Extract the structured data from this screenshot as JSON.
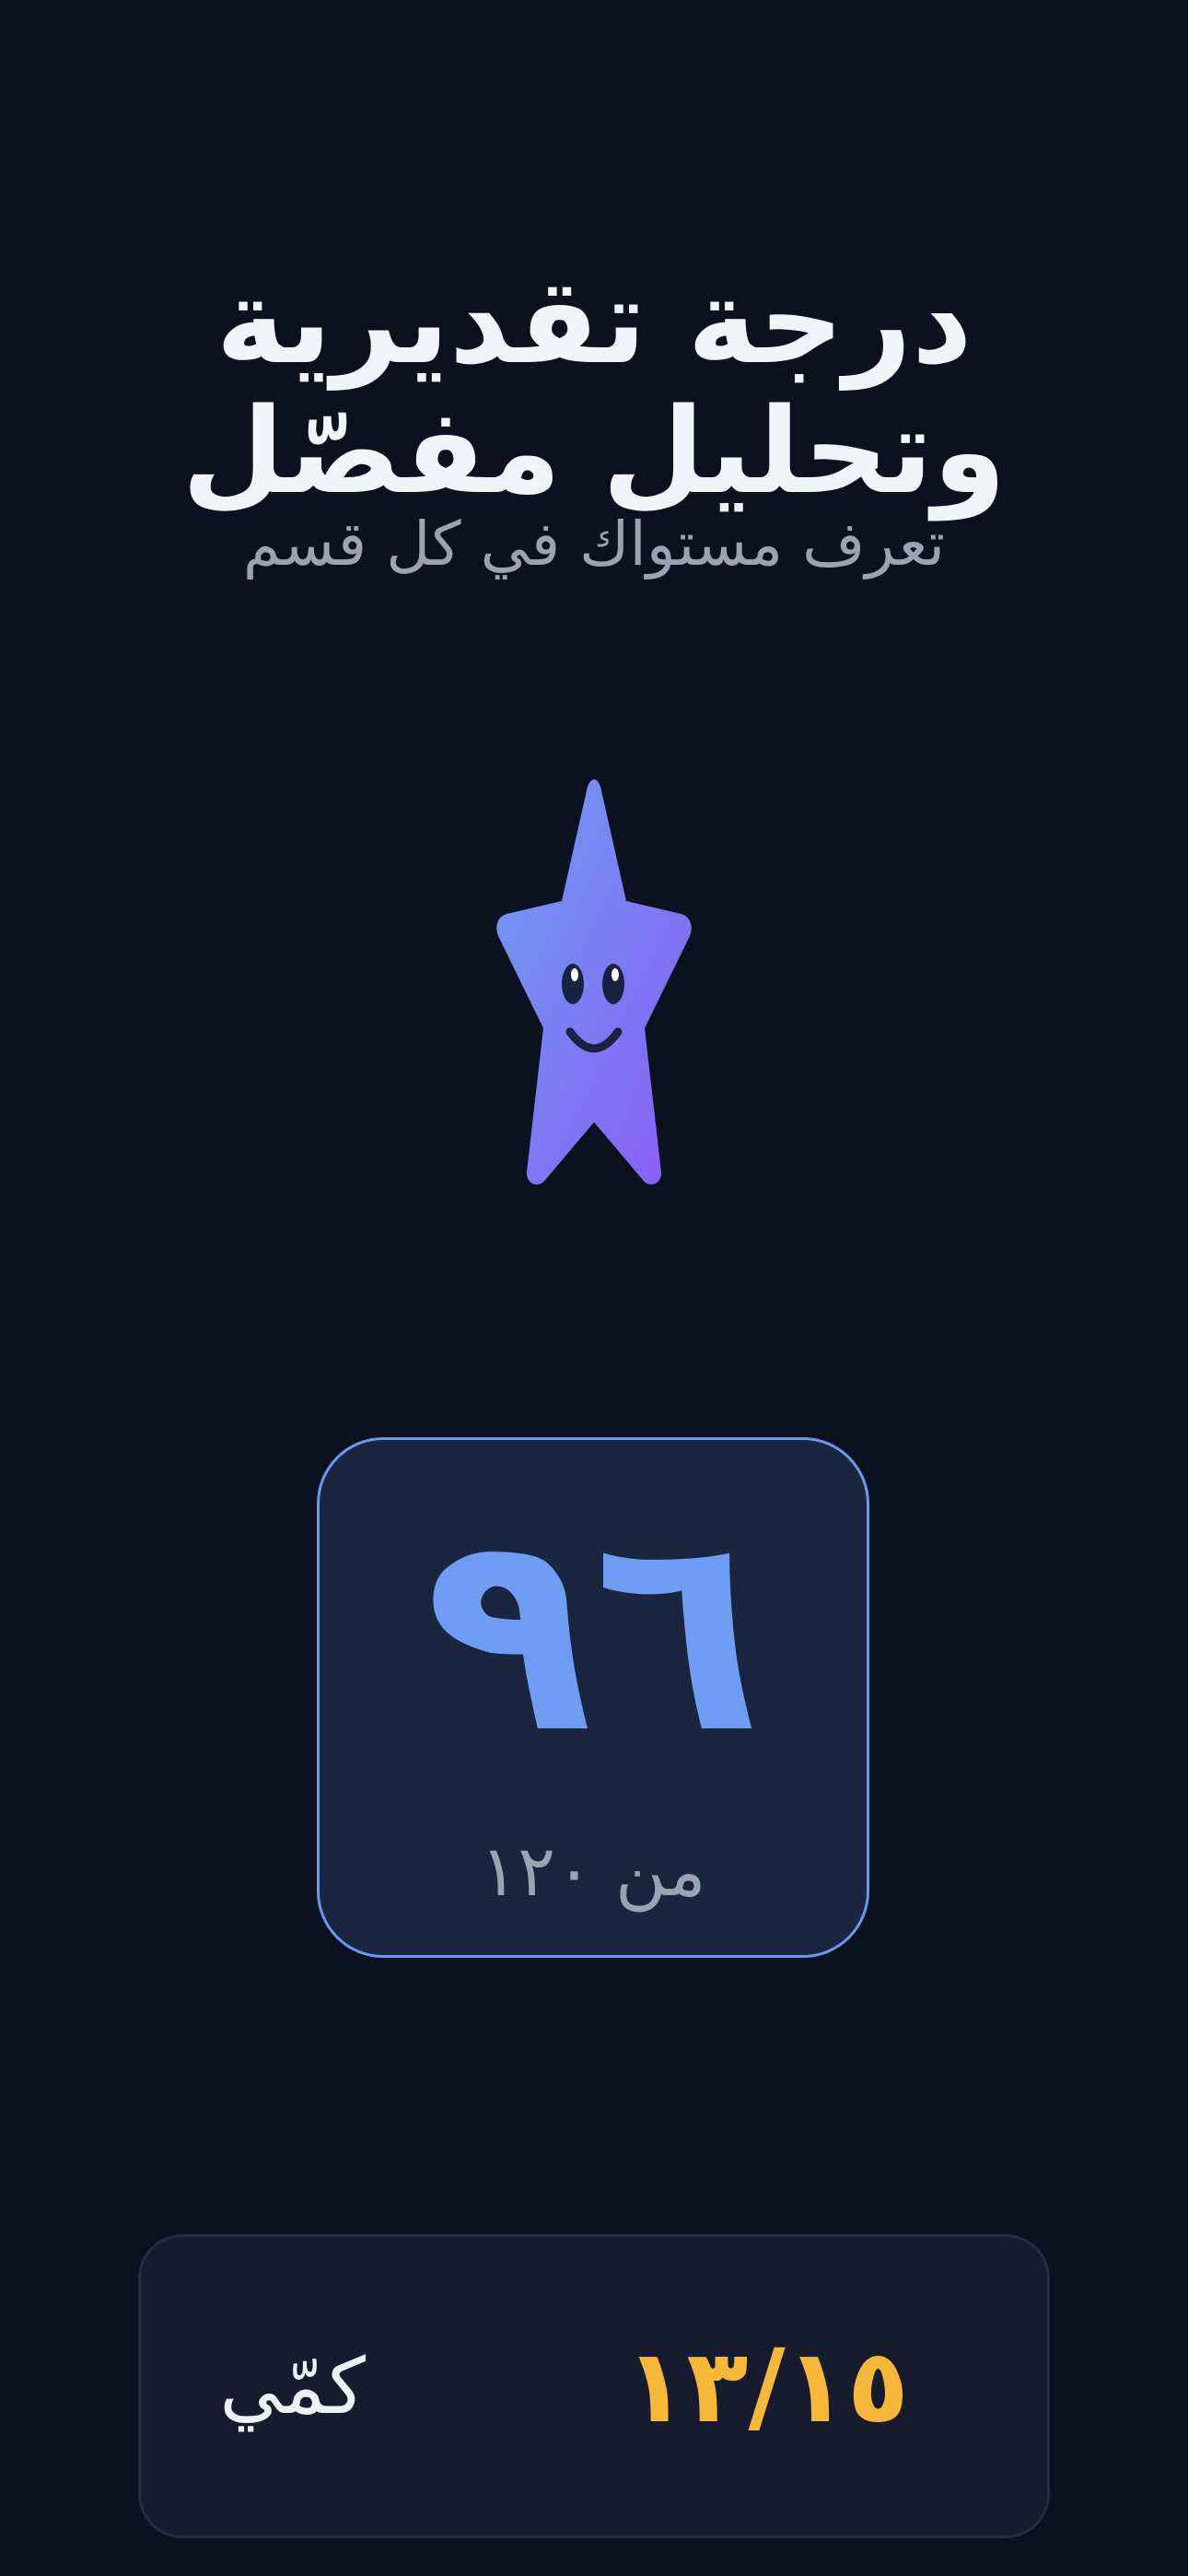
{
  "header": {
    "title": "درجة تقديرية وتحليل مفصّل",
    "subtitle": "تعرف مستواك في كل قسم"
  },
  "mascot": {
    "icon": "star-mascot-icon",
    "colors": {
      "gradient_start": "#6f9df3",
      "gradient_end": "#8a5cf5",
      "face": "#17233f"
    }
  },
  "score": {
    "value": "٩٦",
    "total_label": "من ١٢٠",
    "accent_color": "#6f9df3"
  },
  "sections": [
    {
      "label": "كمّي",
      "score": "١٣/١٥",
      "score_color": "#f7b83a"
    }
  ]
}
